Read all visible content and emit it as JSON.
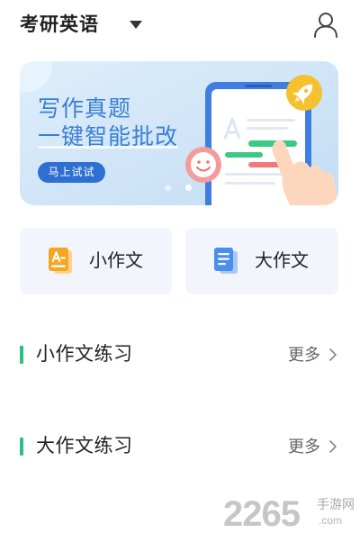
{
  "header": {
    "title": "考研英语",
    "dropdown_icon": "caret-down-icon",
    "profile_icon": "user-icon"
  },
  "banner": {
    "headline": "写作真题",
    "subheadline": "一键智能批改",
    "cta_label": "马上试试",
    "illustration_icons": [
      "phone-document-icon",
      "smiley-icon",
      "pointing-hand-icon",
      "rocket-icon"
    ],
    "carousel": {
      "count": 2,
      "active_index": 1
    }
  },
  "cards": [
    {
      "label": "小作文",
      "icon": "document-a-icon"
    },
    {
      "label": "大作文",
      "icon": "document-lines-icon"
    }
  ],
  "sections": [
    {
      "title": "小作文练习",
      "more_label": "更多",
      "more_icon": "chevron-right-icon"
    },
    {
      "title": "大作文练习",
      "more_label": "更多",
      "more_icon": "chevron-right-icon"
    }
  ],
  "watermark": {
    "brand": "2265",
    "site_name": "手游网",
    "domain": ".com"
  },
  "colors": {
    "banner_text": "#3a7fd5",
    "cta_background": "#2f6fd1",
    "section_marker": "#2cc17a",
    "card_background": "#f2f6fc",
    "small_essay_icon": "#f5a623",
    "large_essay_icon": "#4a8ef0",
    "rocket_badge": "#f5c12e"
  }
}
